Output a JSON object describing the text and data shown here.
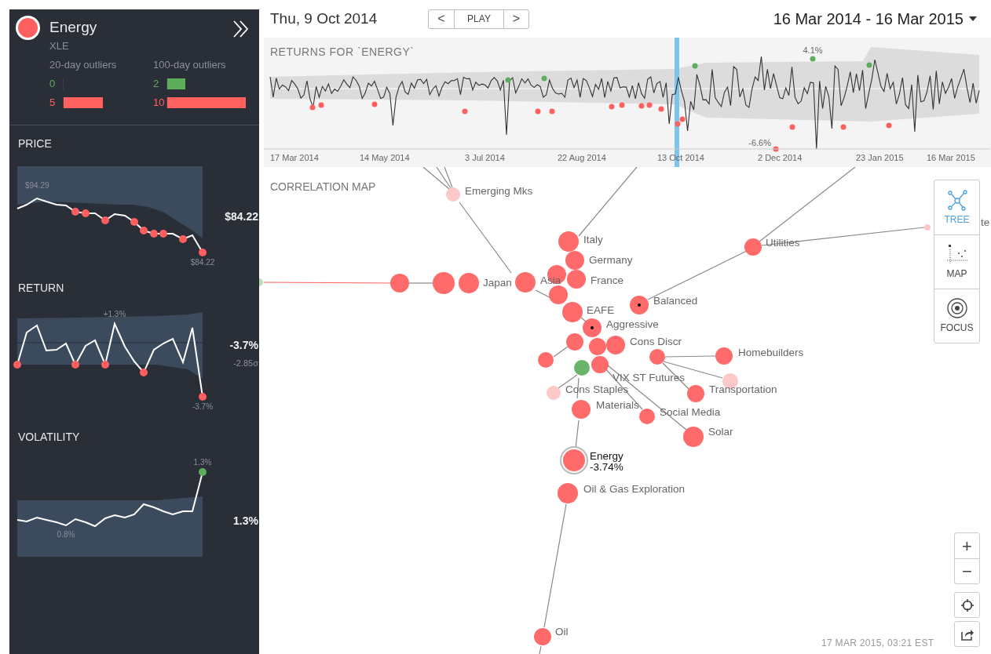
{
  "sidebar": {
    "title": "Energy",
    "ticker": "XLE",
    "color": "#ff5f5f",
    "outliers": [
      {
        "heading": "20-day outliers",
        "positive": {
          "count": "0"
        },
        "negative": {
          "count": "5",
          "level": 0.5
        }
      },
      {
        "heading": "100-day outliers",
        "positive": {
          "count": "2",
          "level": 0.23
        },
        "negative": {
          "count": "10",
          "level": 1
        }
      }
    ],
    "metrics": [
      {
        "title": "PRICE",
        "value": "$84.22",
        "labels": [
          "$94.29",
          "$84.22"
        ]
      },
      {
        "title": "RETURN",
        "value": "-3.7%",
        "sub_value": "-2.85σ",
        "labels": [
          "+1.3%",
          "-3.7%"
        ]
      },
      {
        "title": "VOLATILITY",
        "value": "1.3%",
        "labels": [
          "1.3%",
          "0.8%"
        ]
      }
    ]
  },
  "toolbar": {
    "date": "Thu, 9 Oct 2014",
    "buttons": [
      "<",
      "PLAY",
      ">"
    ],
    "range": "16 Mar 2014 - 16 Mar 2015"
  },
  "returns": {
    "title": "RETURNS FOR `ENERGY`",
    "xticks": [
      "17 Mar 2014",
      "14 May 2014",
      "3 Jul 2014",
      "22 Aug 2014",
      "13 Oct 2014",
      "2 Dec 2014",
      "23 Jan 2015",
      "16 Mar 2015"
    ],
    "annotations": [
      "4.1%",
      "-6.6%"
    ]
  },
  "map": {
    "title": "CORRELATION MAP",
    "nodes": [
      {
        "label": "Emerging Mks",
        "color": "#fcc4c4",
        "kind": "asset"
      },
      {
        "label": "Italy",
        "color": "#ff5f5f",
        "kind": "asset"
      },
      {
        "label": "Germany",
        "color": "#ff5f5f",
        "kind": "asset"
      },
      {
        "color": "#ff5f5f",
        "kind": "asset"
      },
      {
        "label": "France",
        "color": "#ff5f5f",
        "kind": "asset"
      },
      {
        "color": "#ff5f5f",
        "kind": "asset"
      },
      {
        "label": "EAFE",
        "color": "#ff5f5f",
        "kind": "asset"
      },
      {
        "label": "te",
        "color": "#fcc4c4",
        "kind": "asset"
      },
      {
        "label": "Utilities",
        "color": "#ff5f5f",
        "kind": "asset"
      },
      {
        "color": "#ff5f5f",
        "kind": "asset"
      },
      {
        "color": "#ff5f5f",
        "kind": "asset"
      },
      {
        "label": "Japan",
        "color": "#ff5f5f",
        "kind": "asset"
      },
      {
        "label": "Asia",
        "color": "#ff5f5f",
        "kind": "asset"
      },
      {
        "label": "Balanced",
        "color": "#ff5f5f",
        "kind": "portfolio"
      },
      {
        "label": "Aggressive",
        "color": "#ff5f5f",
        "kind": "portfolio"
      },
      {
        "color": "#ff5f5f",
        "kind": "asset"
      },
      {
        "color": "#ff5f5f",
        "kind": "asset"
      },
      {
        "label": "Cons Discr",
        "color": "#ff5f5f",
        "kind": "asset"
      },
      {
        "label": "VIX ST Futures",
        "color": "#ff5f5f",
        "kind": "asset"
      },
      {
        "color": "#ff5f5f",
        "kind": "asset"
      },
      {
        "color": "#ff5f5f",
        "kind": "asset"
      },
      {
        "color": "#5cae5c",
        "kind": "asset"
      },
      {
        "label": "Homebuilders",
        "color": "#ff5f5f",
        "kind": "asset"
      },
      {
        "color": "#fcc4c4",
        "kind": "asset"
      },
      {
        "label": "Transportation",
        "color": "#ff5f5f",
        "kind": "asset"
      },
      {
        "label": "Cons Staples",
        "color": "#fcc4c4",
        "kind": "asset"
      },
      {
        "label": "Materials",
        "color": "#ff5f5f",
        "kind": "asset"
      },
      {
        "label": "Social Media",
        "color": "#ff5f5f",
        "kind": "asset"
      },
      {
        "label": "Solar",
        "color": "#ff5f5f",
        "kind": "asset"
      },
      {
        "label": "Energy",
        "value": "-3.74%",
        "color": "#ff5f5f",
        "kind": "focus"
      },
      {
        "label": "Oil & Gas Exploration",
        "color": "#ff5f5f",
        "kind": "asset"
      },
      {
        "label": "Oil",
        "color": "#ff5f5f",
        "kind": "asset"
      },
      {
        "color": "#b8dcb8",
        "kind": "asset"
      }
    ],
    "view_modes": [
      {
        "label": "TREE",
        "selected": true
      },
      {
        "label": "MAP",
        "selected": false
      },
      {
        "label": "FOCUS",
        "selected": false
      }
    ],
    "zoom_buttons": [
      "+",
      "−"
    ],
    "timestamp": "17 MAR 2015, 03:21 EST"
  }
}
